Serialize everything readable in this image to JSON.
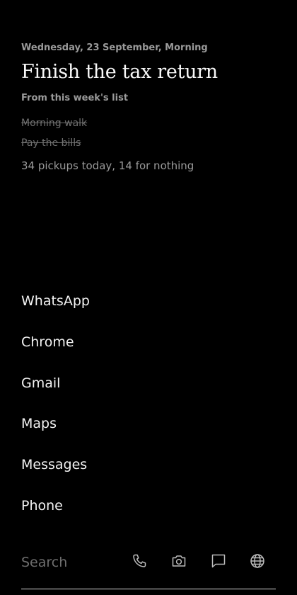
{
  "header": {
    "date": "Wednesday, 23 September, Morning",
    "focus_title": "Finish the tax return",
    "focus_subtitle": "From this week's list"
  },
  "tasks": [
    {
      "label": "Morning walk",
      "done": true
    },
    {
      "label": "Pay the bills",
      "done": true
    }
  ],
  "stats": {
    "pickups": "34 pickups today, 14 for nothing"
  },
  "apps": [
    {
      "label": "WhatsApp"
    },
    {
      "label": "Chrome"
    },
    {
      "label": "Gmail"
    },
    {
      "label": "Maps"
    },
    {
      "label": "Messages"
    },
    {
      "label": "Phone"
    }
  ],
  "dock": {
    "search_placeholder": "Search",
    "icons": [
      "phone-icon",
      "camera-icon",
      "message-icon",
      "globe-icon"
    ]
  },
  "colors": {
    "background": "#000000",
    "text": "#f2f2f2",
    "muted": "#9a9a9a",
    "done": "#707070"
  }
}
